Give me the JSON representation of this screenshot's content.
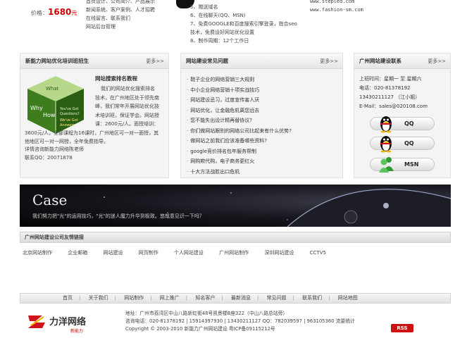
{
  "top": {
    "price_label": "价格：",
    "price_value": "1680",
    "price_unit": "元",
    "col1": [
      "首页设计、公司简介、产品展示",
      "新闻系统、客户案例、人才招聘",
      "在线留言、联系我们",
      "网站后台管理"
    ],
    "col2": [
      "5、赠送域名",
      "6、在线聊天(QQ、MSN)",
      "7、免费GOOGLE和百度搜索引擎登录，指合seo",
      "技术，免费设好网站优化设置",
      "8、制作周期：12个工作日"
    ],
    "col3": [
      "www.stepled.com",
      "www.fashion-sm.com"
    ]
  },
  "panel1": {
    "title": "新能力网站优化培训班招生",
    "more": "更多>>",
    "cube_words": [
      "What",
      "Why",
      "How",
      "You've Got",
      "Questions?",
      "We've Got",
      "Answers."
    ],
    "heading": "网站搜索排名教程",
    "body_indented": [
      "我们的网站优化搜索排名",
      "技术，在广州地区处于领先南",
      "峰，我们常年开展网站优化技",
      "术培训班，保证学会。网站授",
      "课：2600元/人。面授培训："
    ],
    "body_full": [
      "3600元/人，全部课程为16课时，广州地区可一对一面授，其",
      "他地区可一对一网授，全年免费指导。"
    ],
    "footer": [
      "详情咨询新能力网络陈老师",
      "联系QQ：20071878"
    ]
  },
  "panel2": {
    "title": "网站建设常见问题",
    "more": "更多>>",
    "items": [
      "鞋子企业的网络营销三大规则",
      "中小企业网络营销十项实战技巧",
      "网站建设忌习，过度宣传害人厌",
      "网站优化，让金融危机离您远去",
      "您不能失出设计精再替协议?",
      "你们做网站跟别的网络公司比起来有什么优势?",
      "做网站之前我们应该准备哪些资料?",
      "google竞价排名包年服务帮制",
      "网购欺代购，电子商务更红火",
      "十大方法战胜出口危机"
    ]
  },
  "panel3": {
    "title": "广州网站建设联系",
    "more": "更多>>",
    "lines": [
      "上班时间：星期一 至 星期六",
      "电话：020-81378192",
      "13430211127 （江小姐）",
      "E-Mail：sales@020108.com"
    ],
    "buttons": [
      "QQ",
      "QQ",
      "MSN"
    ]
  },
  "case": {
    "title": "Case",
    "subtitle": "我们努力把\"光\"的运用技巧，\"光\"的迷人魔力升华到极致。悠哉意见识一下吗？"
  },
  "friend_links": {
    "title": "广州网站建设公司友情链接",
    "items": [
      "北京网站制作",
      "企业邮箱",
      "网站建设",
      "网页制作",
      "个人网站建设",
      "广州网站制作",
      "深圳网站建设",
      "CCTV5"
    ]
  },
  "footer_nav": [
    "首页",
    "关于我们",
    "网站制作",
    "网上推广",
    "知名客户",
    "最新消息",
    "常见问题",
    "联系我们",
    "网站地图"
  ],
  "footer": {
    "logo_text": "力洋网络",
    "logo_tag": "新能力",
    "lines": [
      "地址：广州市荔湾区中山八路新虹街48号凯景楼B座322（中山八路总站旁）",
      "咨询电话：020-81378192 | 15914397930 | 13430211127  QQ：782039597 | 963105360    流量统计",
      "Copyright © 2003-2010  新能力广州网站建设  粤ICP备09115212号"
    ],
    "rss": "RSS"
  },
  "colors": {
    "accent_red": "#cc0000",
    "banner_dark": "#0a0a0e"
  }
}
